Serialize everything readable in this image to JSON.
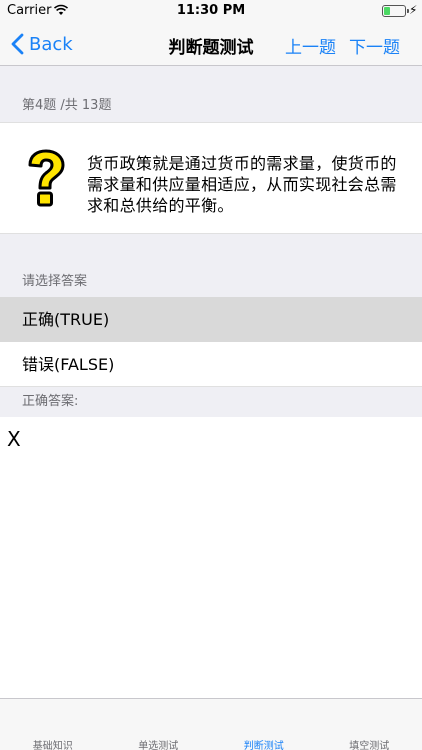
{
  "status_bar": {
    "carrier": "Carrier",
    "time": "11:30 PM",
    "battery_level": 0.3,
    "battery_color": "#4cd964"
  },
  "nav": {
    "back_label": "Back",
    "title": "判断题测试",
    "prev_label": "上一题",
    "next_label": "下一题",
    "accent_color": "#1a82f7"
  },
  "progress": {
    "label": "第4题 /共 13题"
  },
  "question": {
    "icon": "question-mark-icon",
    "text": "货币政策就是通过货币的需求量，使货币的需求量和供应量相适应，从而实现社会总需求和总供给的平衡。"
  },
  "answer_section": {
    "header": "请选择答案",
    "options": [
      {
        "label": "正确(TRUE)",
        "selected": true
      },
      {
        "label": "错误(FALSE)",
        "selected": false
      }
    ]
  },
  "correct_answer": {
    "header": "正确答案:",
    "value": "X"
  },
  "tab_bar": {
    "tabs": [
      {
        "label": "基础知识",
        "active": false
      },
      {
        "label": "单选测试",
        "active": false
      },
      {
        "label": "判断测试",
        "active": true
      },
      {
        "label": "填空测试",
        "active": false
      }
    ]
  }
}
